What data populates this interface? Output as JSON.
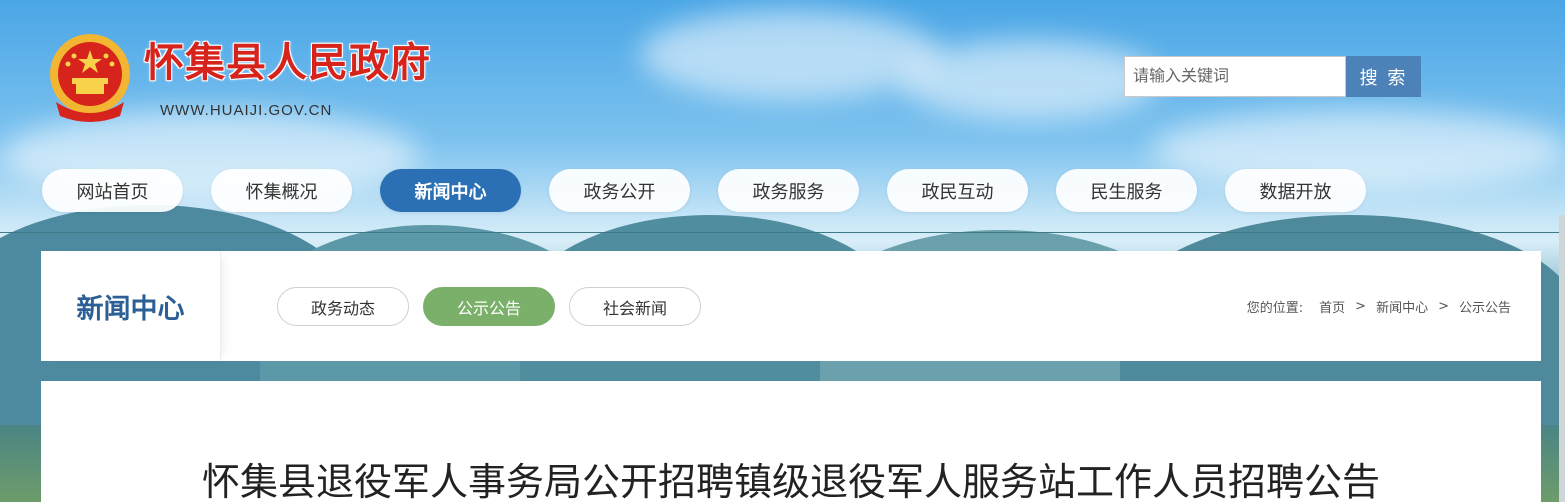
{
  "header": {
    "site_title": "怀集县人民政府",
    "site_domain": "WWW.HUAIJI.GOV.CN",
    "emblem_icon": "national-emblem-icon"
  },
  "search": {
    "placeholder": "请输入关键词",
    "button_label": "搜 索"
  },
  "nav": {
    "items": [
      {
        "label": "网站首页",
        "active": false
      },
      {
        "label": "怀集概况",
        "active": false
      },
      {
        "label": "新闻中心",
        "active": true
      },
      {
        "label": "政务公开",
        "active": false
      },
      {
        "label": "政务服务",
        "active": false
      },
      {
        "label": "政民互动",
        "active": false
      },
      {
        "label": "民生服务",
        "active": false
      },
      {
        "label": "数据开放",
        "active": false
      }
    ]
  },
  "section": {
    "title": "新闻中心",
    "tabs": [
      {
        "label": "政务动态",
        "active": false
      },
      {
        "label": "公示公告",
        "active": true
      },
      {
        "label": "社会新闻",
        "active": false
      }
    ]
  },
  "breadcrumb": {
    "label": "您的位置:",
    "items": [
      "首页",
      "新闻中心",
      "公示公告"
    ],
    "separator": ">"
  },
  "article": {
    "title": "怀集县退役军人事务局公开招聘镇级退役军人服务站工作人员招聘公告"
  },
  "colors": {
    "nav_active": "#2b70b5",
    "tab_active": "#7ab06a",
    "title_red": "#d6231b",
    "section_title": "#2b5f96",
    "search_button": "#4c82b8"
  }
}
